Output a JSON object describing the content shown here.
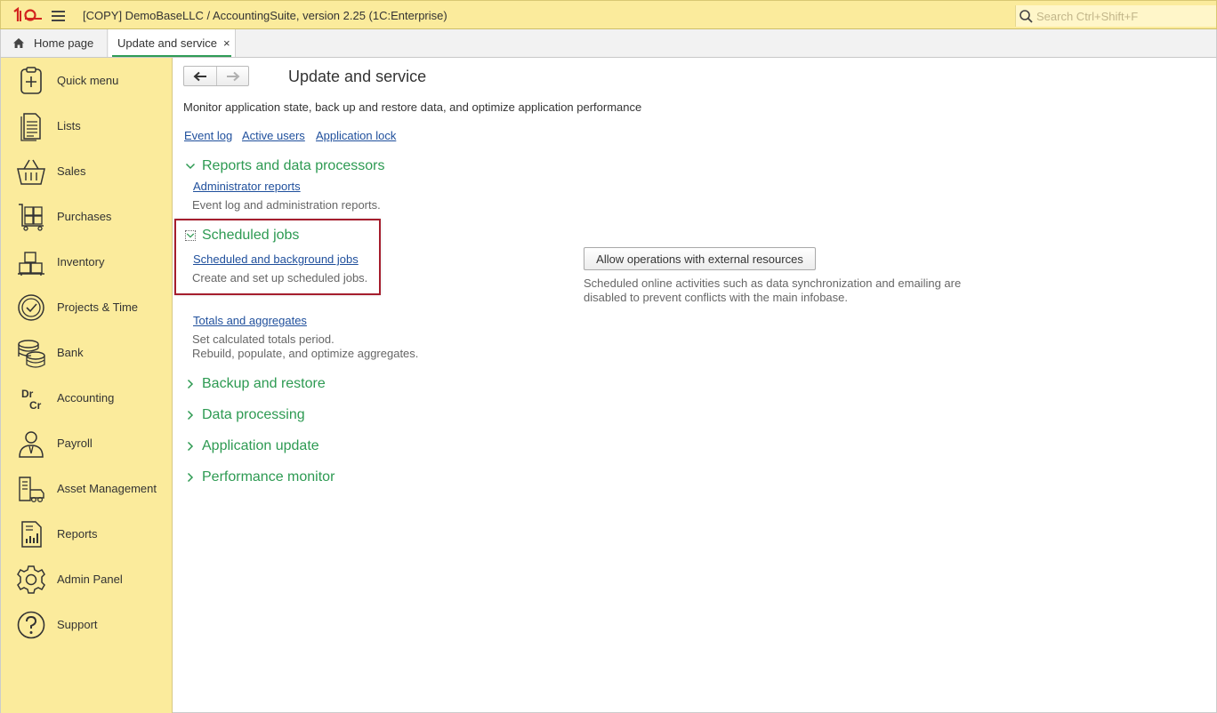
{
  "titlebar": {
    "logo_text": "1C",
    "title": "[COPY] DemoBaseLLC / AccountingSuite, version 2.25  (1C:Enterprise)",
    "search_placeholder": "Search Ctrl+Shift+F",
    "accent_color": "#fbeb9c"
  },
  "tabs": {
    "home_label": "Home page",
    "active_label": "Update and service",
    "close_glyph": "×"
  },
  "sidebar": {
    "items": [
      {
        "label": "Quick menu",
        "icon": "quick-menu-icon"
      },
      {
        "label": "Lists",
        "icon": "lists-icon"
      },
      {
        "label": "Sales",
        "icon": "basket-icon"
      },
      {
        "label": "Purchases",
        "icon": "cart-icon"
      },
      {
        "label": "Inventory",
        "icon": "boxes-icon"
      },
      {
        "label": "Projects & Time",
        "icon": "clock-icon"
      },
      {
        "label": "Bank",
        "icon": "coins-icon"
      },
      {
        "label": "Accounting",
        "icon": "dr-cr-icon"
      },
      {
        "label": "Payroll",
        "icon": "person-icon"
      },
      {
        "label": "Asset Management",
        "icon": "asset-icon"
      },
      {
        "label": "Reports",
        "icon": "report-icon"
      },
      {
        "label": "Admin Panel",
        "icon": "gear-icon"
      },
      {
        "label": "Support",
        "icon": "question-icon"
      }
    ]
  },
  "main": {
    "title": "Update and service",
    "subtitle": "Monitor application state, back up and restore data, and optimize application performance",
    "top_links": {
      "event_log": "Event log",
      "active_users": "Active users",
      "application_lock": "Application lock"
    },
    "reports_section": {
      "title": "Reports and data processors",
      "link": "Administrator reports",
      "desc": "Event log and administration reports."
    },
    "jobs_section": {
      "title": "Scheduled jobs",
      "link": "Scheduled and background jobs",
      "desc": "Create and set up scheduled jobs.",
      "button": "Allow operations with external resources",
      "button_desc_1": "Scheduled online activities such as data synchronization and emailing are",
      "button_desc_2": "disabled to prevent conflicts with the main infobase."
    },
    "totals": {
      "link": "Totals and aggregates",
      "desc_1": "Set calculated totals period.",
      "desc_2": "Rebuild, populate, and optimize aggregates."
    },
    "collapsed_sections": {
      "backup": "Backup and restore",
      "data_processing": "Data processing",
      "app_update": "Application update",
      "perf_monitor": "Performance monitor"
    },
    "section_color": "#2d9a52",
    "highlight_color": "#a51d2d"
  }
}
